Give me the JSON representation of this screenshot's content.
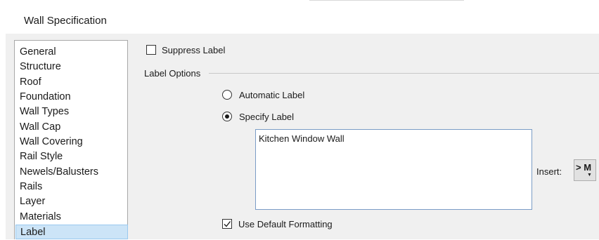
{
  "window": {
    "title": "Wall Specification"
  },
  "nav": {
    "items": [
      {
        "label": "General",
        "selected": false
      },
      {
        "label": "Structure",
        "selected": false
      },
      {
        "label": "Roof",
        "selected": false
      },
      {
        "label": "Foundation",
        "selected": false
      },
      {
        "label": "Wall Types",
        "selected": false
      },
      {
        "label": "Wall Cap",
        "selected": false
      },
      {
        "label": "Wall Covering",
        "selected": false
      },
      {
        "label": "Rail Style",
        "selected": false
      },
      {
        "label": "Newels/Balusters",
        "selected": false
      },
      {
        "label": "Rails",
        "selected": false
      },
      {
        "label": "Layer",
        "selected": false
      },
      {
        "label": "Materials",
        "selected": false
      },
      {
        "label": "Label",
        "selected": true
      }
    ]
  },
  "suppress_label": {
    "label": "Suppress Label",
    "checked": false
  },
  "label_options": {
    "heading": "Label Options",
    "automatic": {
      "label": "Automatic Label",
      "selected": false
    },
    "specify": {
      "label": "Specify Label",
      "selected": true
    },
    "text_value": "Kitchen Window Wall",
    "insert_label": "Insert:",
    "insert_button": "> M",
    "use_default_formatting": {
      "label": "Use Default Formatting",
      "checked": true
    }
  },
  "icons": {
    "insert_dropdown": "chevron-down-icon",
    "checkmark": "checkmark-icon"
  }
}
